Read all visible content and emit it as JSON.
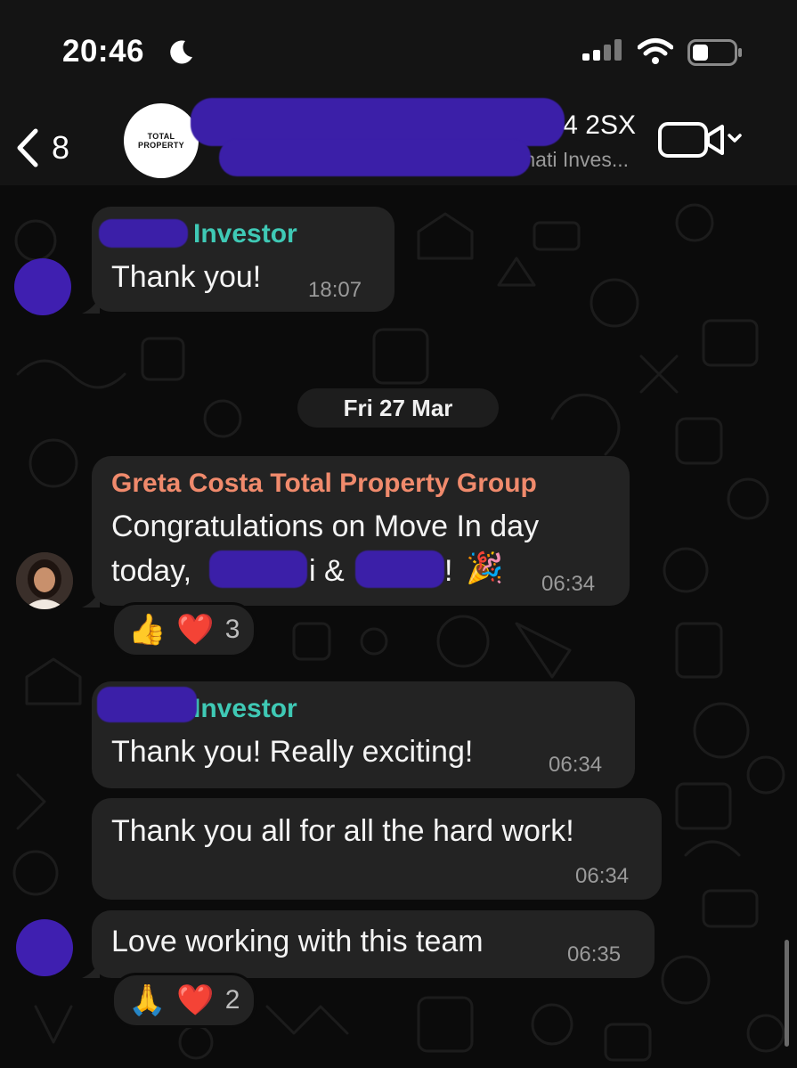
{
  "status_bar": {
    "time": "20:46"
  },
  "header": {
    "back_count": "8",
    "avatar_text_line1": "TOTAL",
    "avatar_text_line2": "PROPERTY",
    "title": "24 2SX",
    "subtitle": "nati Inves..."
  },
  "messages": [
    {
      "sender": "Investor",
      "text": "Thank you!",
      "time": "18:07"
    },
    {
      "date_divider": "Fri 27 Mar"
    },
    {
      "sender": "Greta Costa Total Property Group",
      "text_line1": "Congratulations on Move In day",
      "text_line2_part1": "today,",
      "text_line2_part2": "i &",
      "text_line2_part3": "!",
      "time": "06:34",
      "reactions": {
        "emoji1": "👍",
        "emoji2": "❤️",
        "count": "3"
      }
    },
    {
      "sender": "Investor",
      "text": "Thank you! Really exciting!",
      "time": "06:34"
    },
    {
      "text": "Thank you all for all the hard work!",
      "time": "06:34"
    },
    {
      "text": "Love working with this team",
      "time": "06:35",
      "reactions": {
        "emoji1": "🙏",
        "emoji2": "❤️",
        "count": "2"
      }
    }
  ],
  "colors": {
    "background": "#0b0b0b",
    "bubble": "#232323",
    "investor_name": "#3fc9b5",
    "greta_name": "#f08a6c"
  }
}
